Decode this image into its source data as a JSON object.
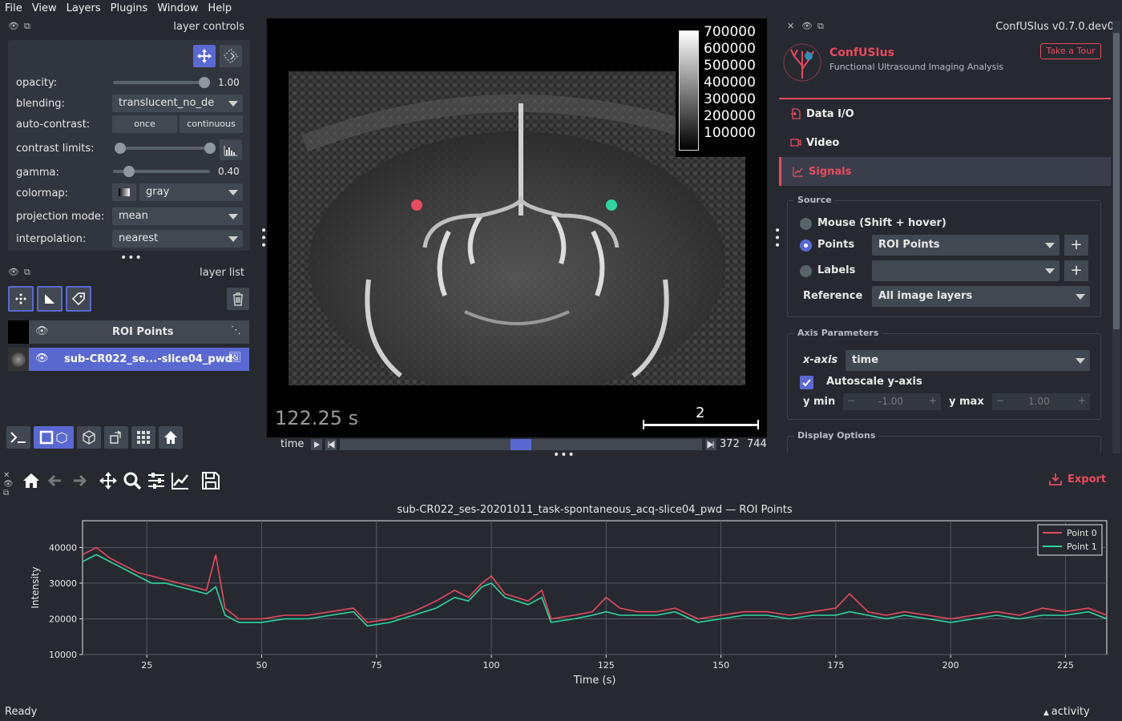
{
  "menu": [
    "File",
    "View",
    "Layers",
    "Plugins",
    "Window",
    "Help"
  ],
  "layer_controls": {
    "title": "layer controls",
    "opacity_label": "opacity:",
    "opacity_value": "1.00",
    "opacity": 1.0,
    "blending_label": "blending:",
    "blending_value": "translucent_no_de",
    "autocontrast_label": "auto-contrast:",
    "once": "once",
    "continuous": "continuous",
    "contrast_label": "contrast limits:",
    "gamma_label": "gamma:",
    "gamma_value": "0.40",
    "colormap_label": "colormap:",
    "colormap_value": "gray",
    "projection_label": "projection mode:",
    "projection_value": "mean",
    "interpolation_label": "interpolation:",
    "interpolation_value": "nearest"
  },
  "layer_list": {
    "title": "layer list",
    "layers": [
      {
        "name": "ROI Points",
        "selected": false
      },
      {
        "name": "sub-CR022_se...-slice04_pwd",
        "selected": true
      }
    ]
  },
  "canvas": {
    "time_text": "122.25 s",
    "colorbar_ticks": [
      "700000",
      "600000",
      "500000",
      "400000",
      "300000",
      "200000",
      "100000"
    ],
    "scalebar_label": "2",
    "point_colors": [
      "#e84a5f",
      "#2ed7a0"
    ]
  },
  "dims": {
    "label": "time",
    "current": "372",
    "total": "744",
    "position": 0.5
  },
  "confusius": {
    "header_title": "ConfUSIus v0.7.0.dev0",
    "app_name": "ConfUSIus",
    "subtitle": "Functional Ultrasound Imaging Analysis",
    "tour_button": "Take a Tour",
    "tabs": [
      "Data I/O",
      "Video",
      "Signals"
    ],
    "source_title": "Source",
    "mouse_option": "Mouse (Shift + hover)",
    "points_option": "Points",
    "points_value": "ROI Points",
    "labels_option": "Labels",
    "labels_value": "",
    "reference_label": "Reference",
    "reference_value": "All image layers",
    "axis_title": "Axis Parameters",
    "xaxis_label": "x-axis",
    "xaxis_value": "time",
    "autoscale_label": "Autoscale y-axis",
    "ymin_label": "y min",
    "ymin_value": "-1.00",
    "ymax_label": "y max",
    "ymax_value": "1.00",
    "display_title": "Display Options"
  },
  "plot_toolbar": {
    "export_label": "Export"
  },
  "chart_data": {
    "type": "line",
    "title": "sub-CR022_ses-20201011_task-spontaneous_acq-slice04_pwd — ROI Points",
    "xlabel": "Time (s)",
    "ylabel": "Intensity",
    "xlim": [
      11,
      234
    ],
    "ylim": [
      10000,
      47500
    ],
    "xticks": [
      25,
      50,
      75,
      100,
      125,
      150,
      175,
      200,
      225
    ],
    "yticks": [
      10000,
      20000,
      30000,
      40000
    ],
    "legend_position": "top-right",
    "grid": true,
    "series": [
      {
        "name": "Point 0",
        "color": "#e84a5f",
        "points": [
          [
            11,
            38000
          ],
          [
            14,
            40000
          ],
          [
            17,
            37000
          ],
          [
            20,
            35000
          ],
          [
            23,
            33000
          ],
          [
            26,
            32000
          ],
          [
            29,
            31000
          ],
          [
            32,
            30000
          ],
          [
            35,
            29000
          ],
          [
            38,
            28000
          ],
          [
            40,
            38000
          ],
          [
            42,
            23000
          ],
          [
            45,
            20000
          ],
          [
            50,
            20000
          ],
          [
            55,
            21000
          ],
          [
            60,
            21000
          ],
          [
            65,
            22000
          ],
          [
            70,
            23000
          ],
          [
            73,
            19000
          ],
          [
            78,
            20000
          ],
          [
            83,
            22000
          ],
          [
            88,
            25000
          ],
          [
            92,
            28000
          ],
          [
            95,
            26000
          ],
          [
            98,
            30000
          ],
          [
            100,
            32000
          ],
          [
            103,
            27000
          ],
          [
            108,
            25000
          ],
          [
            111,
            28000
          ],
          [
            113,
            20000
          ],
          [
            118,
            21000
          ],
          [
            122,
            22000
          ],
          [
            125,
            26000
          ],
          [
            128,
            23000
          ],
          [
            132,
            22000
          ],
          [
            136,
            22000
          ],
          [
            140,
            23000
          ],
          [
            145,
            20000
          ],
          [
            150,
            21000
          ],
          [
            155,
            22000
          ],
          [
            160,
            22000
          ],
          [
            165,
            21000
          ],
          [
            170,
            22000
          ],
          [
            175,
            23000
          ],
          [
            178,
            27000
          ],
          [
            182,
            22000
          ],
          [
            186,
            21000
          ],
          [
            190,
            22000
          ],
          [
            195,
            21000
          ],
          [
            200,
            20000
          ],
          [
            205,
            21000
          ],
          [
            210,
            22000
          ],
          [
            215,
            21000
          ],
          [
            220,
            23000
          ],
          [
            225,
            22000
          ],
          [
            230,
            23000
          ],
          [
            234,
            21000
          ]
        ]
      },
      {
        "name": "Point 1",
        "color": "#2ed7a0",
        "points": [
          [
            11,
            36000
          ],
          [
            14,
            38000
          ],
          [
            17,
            36000
          ],
          [
            20,
            34000
          ],
          [
            23,
            32000
          ],
          [
            26,
            30000
          ],
          [
            29,
            30000
          ],
          [
            32,
            29000
          ],
          [
            35,
            28000
          ],
          [
            38,
            27000
          ],
          [
            40,
            29000
          ],
          [
            42,
            21000
          ],
          [
            45,
            19000
          ],
          [
            50,
            19000
          ],
          [
            55,
            20000
          ],
          [
            60,
            20000
          ],
          [
            65,
            21000
          ],
          [
            70,
            22000
          ],
          [
            73,
            18000
          ],
          [
            78,
            19000
          ],
          [
            83,
            21000
          ],
          [
            88,
            23000
          ],
          [
            92,
            26000
          ],
          [
            95,
            25000
          ],
          [
            98,
            29000
          ],
          [
            100,
            30000
          ],
          [
            103,
            26000
          ],
          [
            108,
            24000
          ],
          [
            111,
            26000
          ],
          [
            113,
            19000
          ],
          [
            118,
            20000
          ],
          [
            122,
            21000
          ],
          [
            125,
            22000
          ],
          [
            128,
            21000
          ],
          [
            132,
            21000
          ],
          [
            136,
            21000
          ],
          [
            140,
            22000
          ],
          [
            145,
            19000
          ],
          [
            150,
            20000
          ],
          [
            155,
            21000
          ],
          [
            160,
            21000
          ],
          [
            165,
            20000
          ],
          [
            170,
            21000
          ],
          [
            175,
            21000
          ],
          [
            178,
            22000
          ],
          [
            182,
            21000
          ],
          [
            186,
            20000
          ],
          [
            190,
            21000
          ],
          [
            195,
            20000
          ],
          [
            200,
            19000
          ],
          [
            205,
            20000
          ],
          [
            210,
            21000
          ],
          [
            215,
            20000
          ],
          [
            220,
            21000
          ],
          [
            225,
            21000
          ],
          [
            230,
            22000
          ],
          [
            234,
            20000
          ]
        ]
      }
    ]
  },
  "status": {
    "left": "Ready",
    "right": "activity"
  }
}
